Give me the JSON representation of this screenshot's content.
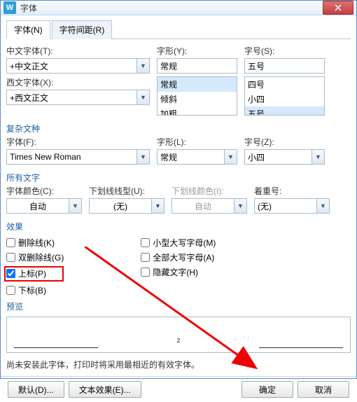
{
  "window": {
    "title": "字体"
  },
  "tabs": {
    "font": "字体(N)",
    "spacing": "字符间距(R)"
  },
  "cnFont": {
    "label": "中文字体(T):",
    "value": "+中文正文"
  },
  "style": {
    "label": "字形(Y):",
    "value": "常规",
    "items": [
      "常规",
      "倾斜",
      "加粗"
    ]
  },
  "size": {
    "label": "字号(S):",
    "value": "五号",
    "items": [
      "四号",
      "小四",
      "五号"
    ]
  },
  "westFont": {
    "label": "西文字体(X):",
    "value": "+西文正文"
  },
  "complex": {
    "title": "复杂文种",
    "fontLabel": "字体(F):",
    "fontValue": "Times New Roman",
    "styleLabel": "字形(L):",
    "styleValue": "常规",
    "sizeLabel": "字号(Z):",
    "sizeValue": "小四"
  },
  "allText": {
    "title": "所有文字",
    "colorLabel": "字体颜色(C):",
    "colorValue": "自动",
    "ulStyleLabel": "下划线线型(U):",
    "ulStyleValue": "(无)",
    "ulColorLabel": "下划线颜色(I):",
    "ulColorValue": "自动",
    "emphasisLabel": "着重号:",
    "emphasisValue": "(无)"
  },
  "effects": {
    "title": "效果",
    "strike": "删除线(K)",
    "dblStrike": "双删除线(G)",
    "super": "上标(P)",
    "sub": "下标(B)",
    "smallCaps": "小型大写字母(M)",
    "allCaps": "全部大写字母(A)",
    "hidden": "隐藏文字(H)"
  },
  "preview": {
    "title": "预览",
    "sample": "2"
  },
  "note": "尚未安装此字体，打印时将采用最相近的有效字体。",
  "buttons": {
    "default": "默认(D)...",
    "textEffects": "文本效果(E)...",
    "ok": "确定",
    "cancel": "取消"
  }
}
